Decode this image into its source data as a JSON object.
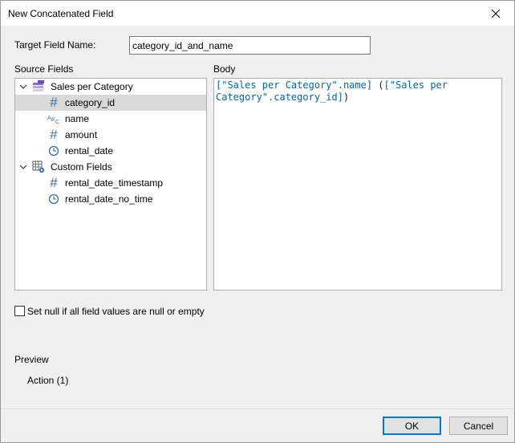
{
  "window": {
    "title": "New Concatenated Field"
  },
  "form": {
    "target_label": "Target Field Name:",
    "target_value": "category_id_and_name",
    "source_fields_label": "Source Fields",
    "body_label": "Body"
  },
  "tree": {
    "groups": [
      {
        "label": "Sales per Category",
        "icon": "table-icon",
        "children": [
          {
            "label": "category_id",
            "icon": "hash-icon",
            "selected": true
          },
          {
            "label": "name",
            "icon": "abc-icon"
          },
          {
            "label": "amount",
            "icon": "hash-icon"
          },
          {
            "label": "rental_date",
            "icon": "clock-icon"
          }
        ]
      },
      {
        "label": "Custom Fields",
        "icon": "custom-table-icon",
        "children": [
          {
            "label": "rental_date_timestamp",
            "icon": "hash-icon"
          },
          {
            "label": "rental_date_no_time",
            "icon": "clock-icon"
          }
        ]
      }
    ]
  },
  "body": {
    "part1": "[\"Sales per Category\".name]",
    "part2": " (",
    "part3": "[\"Sales per Category\".category_id]",
    "part4": ")"
  },
  "options": {
    "set_null_label": "Set null if all field values are null or empty",
    "set_null_checked": false
  },
  "preview": {
    "label": "Preview",
    "action_text": "Action (1)"
  },
  "buttons": {
    "ok": "OK",
    "cancel": "Cancel"
  },
  "colors": {
    "accent": "#0078d7",
    "body_text": "#0066a8",
    "icon_blue": "#3c6e9e",
    "selected_bg": "#d9d9d9"
  }
}
